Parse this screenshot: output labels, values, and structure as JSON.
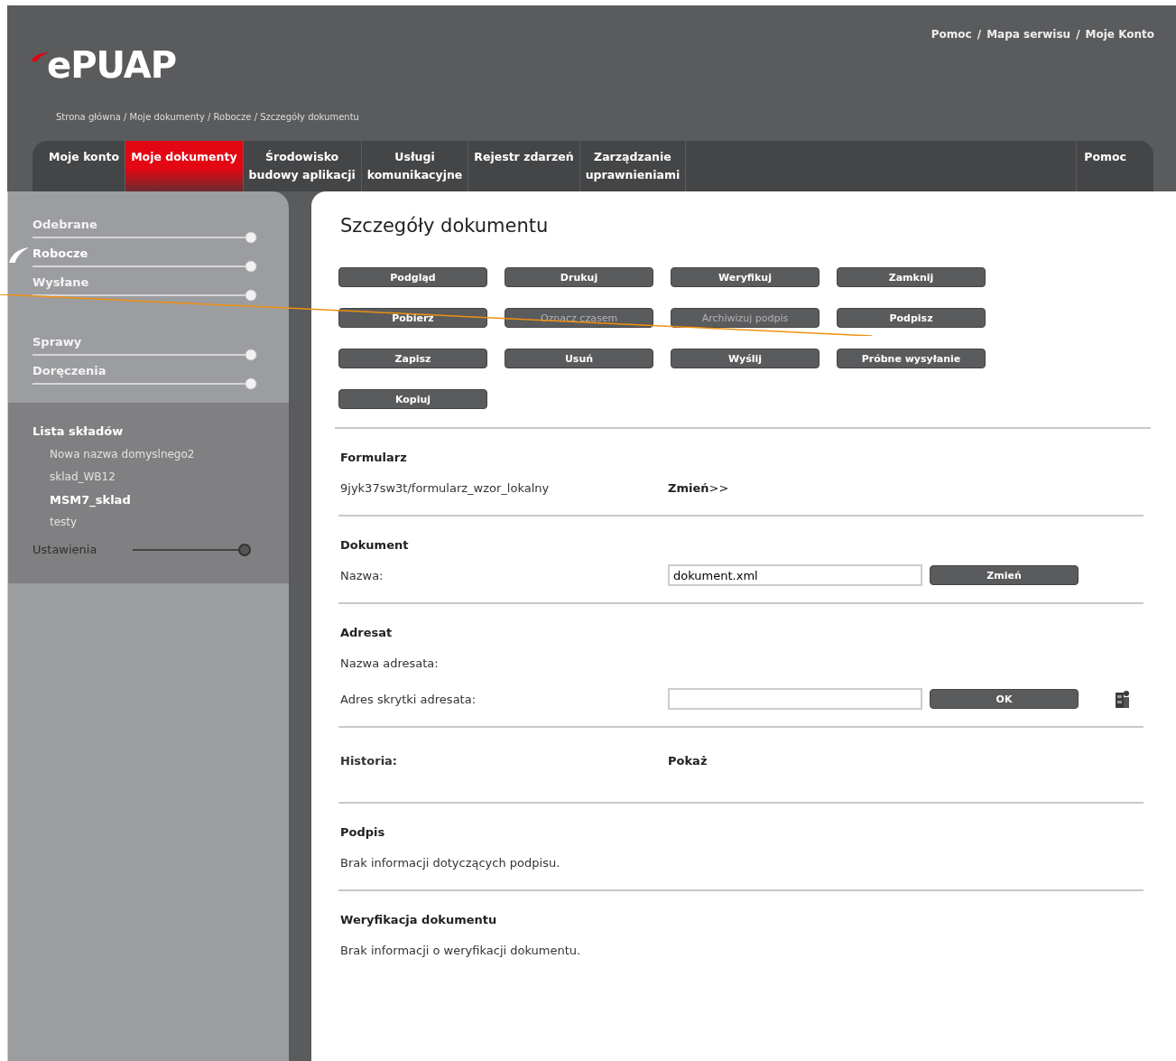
{
  "header": {
    "logo": "ePUAP",
    "link_separator": "/",
    "top_links": [
      "Pomoc",
      "Mapa serwisu",
      "Moje Konto"
    ],
    "breadcrumb": "Strona główna / Moje dokumenty / Robocze / Szczegóły dokumentu"
  },
  "nav_tabs": [
    {
      "label": "Moje konto",
      "selected": false
    },
    {
      "label": "Moje dokumenty",
      "selected": true
    },
    {
      "label": "Środowisko\nbudowy aplikacji",
      "selected": false
    },
    {
      "label": "Usługi\nkomunikacyjne",
      "selected": false
    },
    {
      "label": "Rejestr zdarzeń",
      "selected": false
    },
    {
      "label": "Zarządzanie\nuprawnieniami",
      "selected": false
    },
    {
      "label": "Pomoc",
      "selected": false
    }
  ],
  "sidebar": {
    "menu_groups": [
      [
        {
          "label": "Odebrane",
          "selected": false
        },
        {
          "label": "Robocze",
          "selected": true
        },
        {
          "label": "Wysłane",
          "selected": false
        }
      ],
      [
        {
          "label": "Sprawy",
          "selected": false
        },
        {
          "label": "Doręczenia",
          "selected": false
        }
      ]
    ],
    "stores": {
      "title": "Lista składów",
      "items": [
        {
          "label": "Nowa nazwa domyslnego2",
          "selected": false
        },
        {
          "label": "sklad_WB12",
          "selected": false
        },
        {
          "label": "MSM7_sklad",
          "selected": true
        },
        {
          "label": "testy",
          "selected": false
        }
      ]
    },
    "settings": "Ustawienia"
  },
  "content": {
    "title": "Szczegóły dokumentu",
    "buttons": [
      {
        "label": "Podgląd",
        "disabled": false
      },
      {
        "label": "Drukuj",
        "disabled": false
      },
      {
        "label": "Weryfikuj",
        "disabled": false
      },
      {
        "label": "Zamknij",
        "disabled": false
      },
      {
        "label": "Pobierz",
        "disabled": false
      },
      {
        "label": "Oznacz czasem",
        "disabled": true
      },
      {
        "label": "Archiwizuj podpis",
        "disabled": true
      },
      {
        "label": "Podpisz",
        "disabled": false
      },
      {
        "label": "Zapisz",
        "disabled": false
      },
      {
        "label": "Usuń",
        "disabled": false
      },
      {
        "label": "Wyślij",
        "disabled": false
      },
      {
        "label": "Próbne wysyłanie",
        "disabled": false
      },
      {
        "label": "Kopiuj",
        "disabled": false
      }
    ],
    "sections": [
      {
        "heading": "Formularz",
        "rows": [
          {
            "kind": "link",
            "label": "9jyk37sw3t/formularz_wzor_lokalny",
            "link": "**Zmień**>>"
          }
        ]
      },
      {
        "heading": "Dokument",
        "rows": [
          {
            "kind": "field",
            "label": "Nazwa:",
            "value": "dokument.xml",
            "button": "Zmień"
          }
        ]
      },
      {
        "heading": "Adresat",
        "rows": [
          {
            "kind": "label",
            "label": "Nazwa adresata:"
          },
          {
            "kind": "field_lookup",
            "label": "Adres skrytki adresata:",
            "value": "",
            "button": "OK"
          }
        ]
      },
      {
        "heading": "Historia:",
        "inline_link": "Pokaż"
      },
      {
        "heading": "Podpis",
        "rows": [
          {
            "kind": "text",
            "label": "Brak informacji dotyczących podpisu."
          }
        ]
      },
      {
        "heading": "Weryfikacja dokumentu",
        "rows": [
          {
            "kind": "text",
            "label": "Brak informacji o weryfikacji dokumentu."
          }
        ]
      }
    ]
  },
  "annotation": {
    "kind": "line"
  }
}
